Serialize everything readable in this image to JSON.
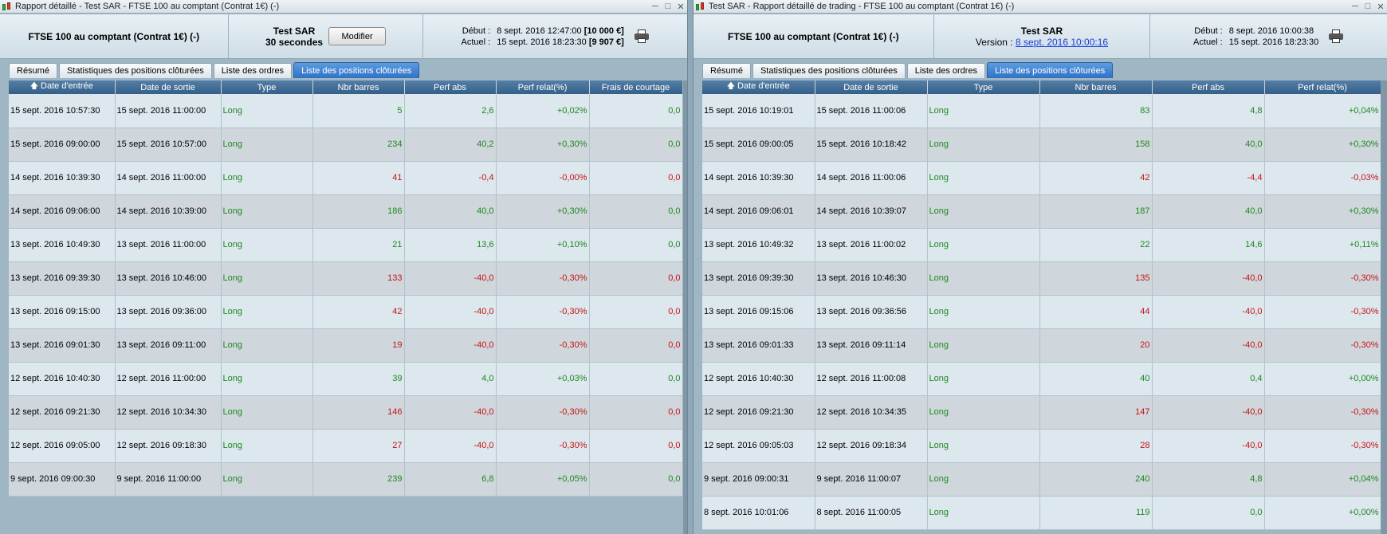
{
  "left": {
    "window_title": "Rapport détaillé - Test SAR - FTSE 100 au comptant (Contrat 1€) (-)",
    "instrument": "FTSE 100 au comptant (Contrat 1€) (-)",
    "test_name": "Test SAR",
    "timeframe": "30 secondes",
    "modify_label": "Modifier",
    "start_label": "Début :",
    "start_value": "8 sept. 2016 12:47:00",
    "start_capital": "[10 000 €]",
    "current_label": "Actuel :",
    "current_value": "15 sept. 2016 18:23:30",
    "current_capital": "[9 907 €]",
    "tabs": [
      "Résumé",
      "Statistiques des positions clôturées",
      "Liste des ordres",
      "Liste des positions clôturées"
    ],
    "columns": [
      "Date d'entrée",
      "Date de sortie",
      "Type",
      "Nbr barres",
      "Perf abs",
      "Perf relat(%)",
      "Frais de courtage"
    ],
    "rows": [
      [
        "15 sept. 2016 10:57:30",
        "15 sept. 2016 11:00:00",
        "Long",
        "5",
        "2,6",
        "+0,02%",
        "0,0"
      ],
      [
        "15 sept. 2016 09:00:00",
        "15 sept. 2016 10:57:00",
        "Long",
        "234",
        "40,2",
        "+0,30%",
        "0,0"
      ],
      [
        "14 sept. 2016 10:39:30",
        "14 sept. 2016 11:00:00",
        "Long",
        "41",
        "-0,4",
        "-0,00%",
        "0,0"
      ],
      [
        "14 sept. 2016 09:06:00",
        "14 sept. 2016 10:39:00",
        "Long",
        "186",
        "40,0",
        "+0,30%",
        "0,0"
      ],
      [
        "13 sept. 2016 10:49:30",
        "13 sept. 2016 11:00:00",
        "Long",
        "21",
        "13,6",
        "+0,10%",
        "0,0"
      ],
      [
        "13 sept. 2016 09:39:30",
        "13 sept. 2016 10:46:00",
        "Long",
        "133",
        "-40,0",
        "-0,30%",
        "0,0"
      ],
      [
        "13 sept. 2016 09:15:00",
        "13 sept. 2016 09:36:00",
        "Long",
        "42",
        "-40,0",
        "-0,30%",
        "0,0"
      ],
      [
        "13 sept. 2016 09:01:30",
        "13 sept. 2016 09:11:00",
        "Long",
        "19",
        "-40,0",
        "-0,30%",
        "0,0"
      ],
      [
        "12 sept. 2016 10:40:30",
        "12 sept. 2016 11:00:00",
        "Long",
        "39",
        "4,0",
        "+0,03%",
        "0,0"
      ],
      [
        "12 sept. 2016 09:21:30",
        "12 sept. 2016 10:34:30",
        "Long",
        "146",
        "-40,0",
        "-0,30%",
        "0,0"
      ],
      [
        "12 sept. 2016 09:05:00",
        "12 sept. 2016 09:18:30",
        "Long",
        "27",
        "-40,0",
        "-0,30%",
        "0,0"
      ],
      [
        "9 sept. 2016 09:00:30",
        "9 sept. 2016 11:00:00",
        "Long",
        "239",
        "6,8",
        "+0,05%",
        "0,0"
      ]
    ]
  },
  "right": {
    "window_title": "Test SAR - Rapport détaillé de trading - FTSE 100 au comptant (Contrat 1€) (-)",
    "instrument": "FTSE 100 au comptant (Contrat 1€) (-)",
    "test_name": "Test SAR",
    "version_label": "Version :",
    "version_link": "8 sept. 2016 10:00:16",
    "start_label": "Début :",
    "start_value": "8 sept. 2016 10:00:38",
    "current_label": "Actuel :",
    "current_value": "15 sept. 2016 18:23:30",
    "tabs": [
      "Résumé",
      "Statistiques des positions clôturées",
      "Liste des ordres",
      "Liste des positions clôturées"
    ],
    "columns": [
      "Date d'entrée",
      "Date de sortie",
      "Type",
      "Nbr barres",
      "Perf abs",
      "Perf relat(%)"
    ],
    "rows": [
      [
        "15 sept. 2016 10:19:01",
        "15 sept. 2016 11:00:06",
        "Long",
        "83",
        "4,8",
        "+0,04%"
      ],
      [
        "15 sept. 2016 09:00:05",
        "15 sept. 2016 10:18:42",
        "Long",
        "158",
        "40,0",
        "+0,30%"
      ],
      [
        "14 sept. 2016 10:39:30",
        "14 sept. 2016 11:00:06",
        "Long",
        "42",
        "-4,4",
        "-0,03%"
      ],
      [
        "14 sept. 2016 09:06:01",
        "14 sept. 2016 10:39:07",
        "Long",
        "187",
        "40,0",
        "+0,30%"
      ],
      [
        "13 sept. 2016 10:49:32",
        "13 sept. 2016 11:00:02",
        "Long",
        "22",
        "14,6",
        "+0,11%"
      ],
      [
        "13 sept. 2016 09:39:30",
        "13 sept. 2016 10:46:30",
        "Long",
        "135",
        "-40,0",
        "-0,30%"
      ],
      [
        "13 sept. 2016 09:15:06",
        "13 sept. 2016 09:36:56",
        "Long",
        "44",
        "-40,0",
        "-0,30%"
      ],
      [
        "13 sept. 2016 09:01:33",
        "13 sept. 2016 09:11:14",
        "Long",
        "20",
        "-40,0",
        "-0,30%"
      ],
      [
        "12 sept. 2016 10:40:30",
        "12 sept. 2016 11:00:08",
        "Long",
        "40",
        "0,4",
        "+0,00%"
      ],
      [
        "12 sept. 2016 09:21:30",
        "12 sept. 2016 10:34:35",
        "Long",
        "147",
        "-40,0",
        "-0,30%"
      ],
      [
        "12 sept. 2016 09:05:03",
        "12 sept. 2016 09:18:34",
        "Long",
        "28",
        "-40,0",
        "-0,30%"
      ],
      [
        "9 sept. 2016 09:00:31",
        "9 sept. 2016 11:00:07",
        "Long",
        "240",
        "4,8",
        "+0,04%"
      ],
      [
        "8 sept. 2016 10:01:06",
        "8 sept. 2016 11:00:05",
        "Long",
        "119",
        "0,0",
        "+0,00%"
      ]
    ]
  },
  "colors": {
    "positive": "#1d8a1d",
    "negative": "#c81414",
    "active_tab": "#3a7fd0",
    "header_row": "#3f6a93"
  }
}
